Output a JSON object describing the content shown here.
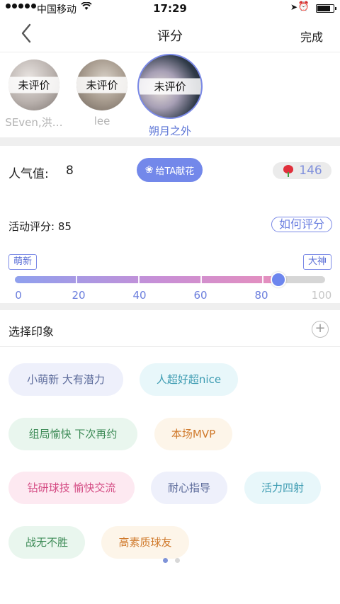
{
  "status_bar": {
    "carrier": "中国移动",
    "time": "17:29",
    "battery_level": 0.85
  },
  "nav": {
    "title": "评分",
    "done_label": "完成"
  },
  "avatars": [
    {
      "overlay": "未评价",
      "name": "SEven,洪…",
      "selected": false
    },
    {
      "overlay": "未评价",
      "name": "lee",
      "selected": false
    },
    {
      "overlay": "未评价",
      "name": "朔月之外",
      "selected": true
    }
  ],
  "popularity": {
    "label": "人气值:",
    "value": "8",
    "flower_button_label": "给TA献花",
    "flower_count": "146"
  },
  "score": {
    "text": "活动评分: 85",
    "value": 85,
    "how_label": "如何评分",
    "low_tag": "萌新",
    "high_tag": "大神",
    "scale": [
      "0",
      "20",
      "40",
      "60",
      "80",
      "100"
    ]
  },
  "impressions": {
    "title": "选择印象",
    "chips": [
      {
        "label": "小萌新 大有潜力",
        "bg": "#eef0fb",
        "color": "#5b6a9a"
      },
      {
        "label": "人超好超nice",
        "bg": "#e8f7fa",
        "color": "#3c9bb1"
      },
      {
        "label": "组局愉快 下次再约",
        "bg": "#e9f6ee",
        "color": "#3b8a55"
      },
      {
        "label": "本场MVP",
        "bg": "#fdf5e9",
        "color": "#d07a2c"
      },
      {
        "label": "钻研球技 愉快交流",
        "bg": "#fde9f1",
        "color": "#d44a83"
      },
      {
        "label": "耐心指导",
        "bg": "#eef0fb",
        "color": "#5b6a9a"
      },
      {
        "label": "活力四射",
        "bg": "#e8f7fa",
        "color": "#3c9bb1"
      },
      {
        "label": "战无不胜",
        "bg": "#e9f6ee",
        "color": "#3b8a55"
      },
      {
        "label": "高素质球友",
        "bg": "#fdf5e9",
        "color": "#d07a2c"
      }
    ],
    "page_count": 2,
    "active_page": 1
  }
}
